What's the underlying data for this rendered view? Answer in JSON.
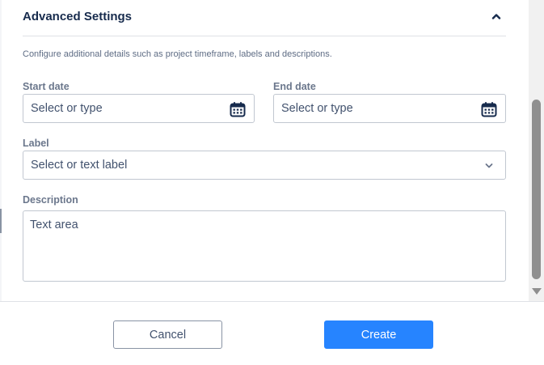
{
  "section": {
    "title": "Advanced Settings",
    "description": "Configure additional details such as project timeframe, labels and descriptions."
  },
  "start_date": {
    "label": "Start date",
    "placeholder": "Select or type"
  },
  "end_date": {
    "label": "End date",
    "placeholder": "Select or type"
  },
  "label_field": {
    "label": "Label",
    "placeholder": "Select or text label"
  },
  "description_field": {
    "label": "Description",
    "placeholder": "Text area"
  },
  "footer": {
    "cancel_label": "Cancel",
    "create_label": "Create"
  },
  "icons": {
    "collapse": "chevron-up-icon",
    "calendar": "calendar-icon",
    "dropdown": "chevron-down-icon",
    "scroll_down": "triangle-down-icon"
  },
  "colors": {
    "primary": "#2684ff",
    "text_dark": "#172b4d",
    "text_muted": "#6b778c",
    "border": "#c1c7d0"
  }
}
